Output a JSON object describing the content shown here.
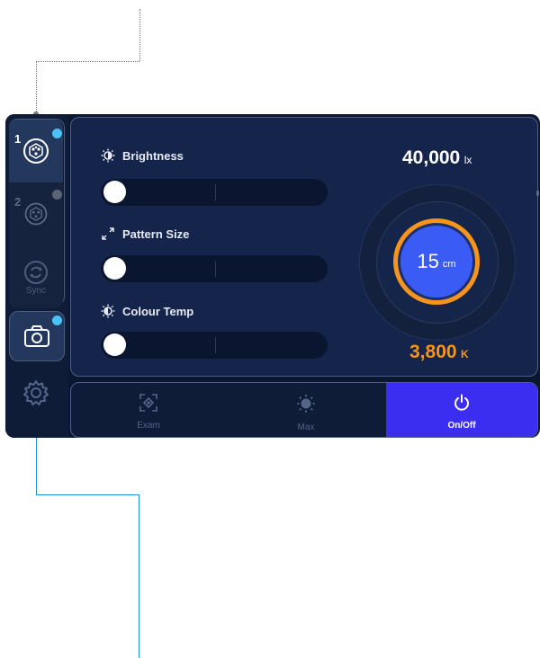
{
  "sidebar": {
    "slot1_number": "1",
    "slot2_number": "2",
    "sync_label": "Sync",
    "active_badge_color": "#4cc2f5",
    "inactive_badge_color": "#5b6478"
  },
  "controls": {
    "brightness_label": "Brightness",
    "pattern_size_label": "Pattern Size",
    "colour_temp_label": "Colour Temp",
    "brightness_level": 0,
    "pattern_size_level": 0,
    "colour_temp_level": 0
  },
  "readouts": {
    "illuminance_value": "40,000",
    "illuminance_unit": "lx",
    "distance_value": "15",
    "distance_unit": "cm",
    "temperature_value": "3,800",
    "temperature_unit": "K"
  },
  "bottom_bar": {
    "exam_label": "Exam",
    "max_label": "Max",
    "onoff_label": "On/Off"
  },
  "colors": {
    "accent_orange": "#f7941d",
    "accent_blue": "#3a5cf5",
    "onoff_active": "#3b2ef0",
    "callout_line": "#1f8fd6"
  }
}
